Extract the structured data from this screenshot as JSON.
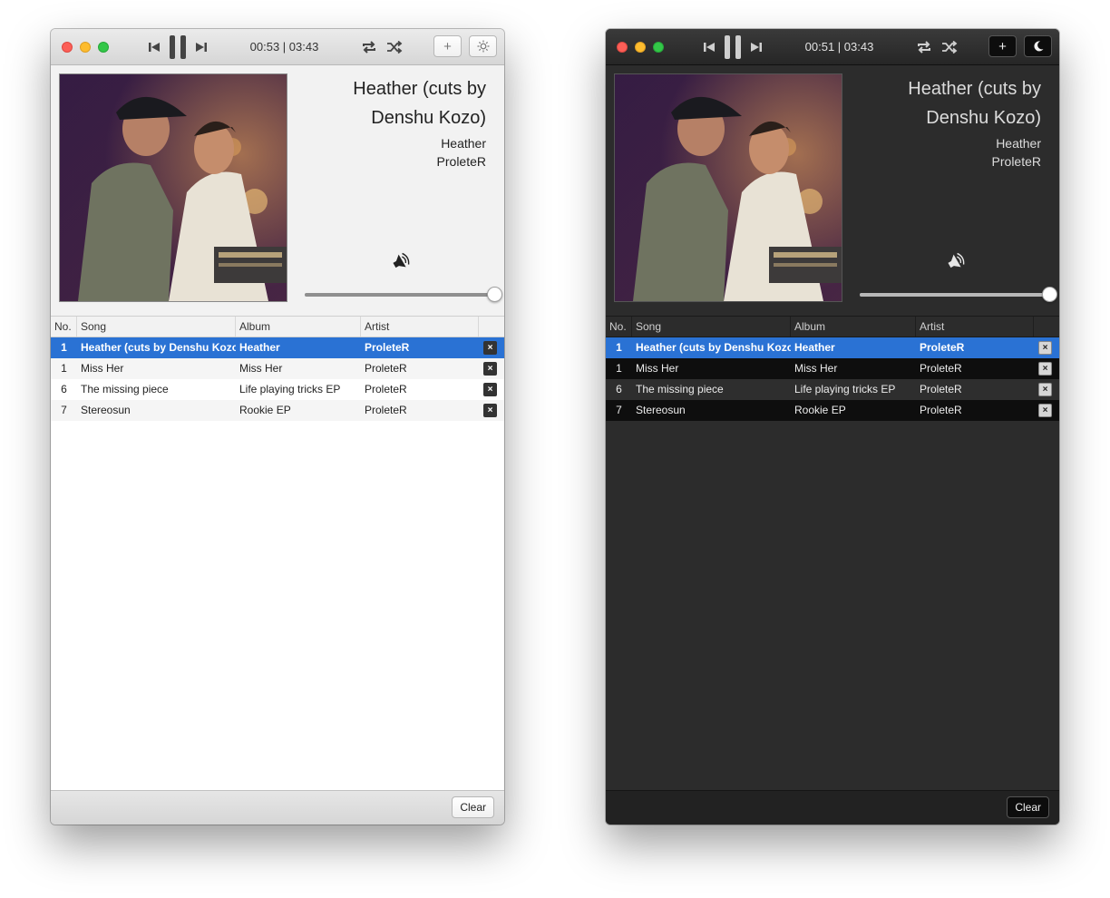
{
  "light": {
    "time": "00:53 | 03:43",
    "now_playing": {
      "title": "Heather (cuts by Denshu Kozo)",
      "album": "Heather",
      "artist": "ProleteR"
    },
    "volume": 1.0,
    "theme_icon": "sun-icon",
    "add_label": "+",
    "footer": {
      "clear_label": "Clear"
    }
  },
  "dark": {
    "time": "00:51 | 03:43",
    "now_playing": {
      "title": "Heather (cuts by Denshu Kozo)",
      "album": "Heather",
      "artist": "ProleteR"
    },
    "volume": 1.0,
    "theme_icon": "moon-icon",
    "add_label": "+",
    "footer": {
      "clear_label": "Clear"
    }
  },
  "columns": {
    "no": "No.",
    "song": "Song",
    "album": "Album",
    "artist": "Artist"
  },
  "tracks": [
    {
      "no": "1",
      "song": "Heather (cuts by Denshu Kozo)",
      "album": "Heather",
      "artist": "ProleteR",
      "selected": true
    },
    {
      "no": "1",
      "song": "Miss Her",
      "album": "Miss Her",
      "artist": "ProleteR",
      "selected": false
    },
    {
      "no": "6",
      "song": "The missing piece",
      "album": "Life playing tricks EP",
      "artist": "ProleteR",
      "selected": false
    },
    {
      "no": "7",
      "song": "Stereosun",
      "album": "Rookie EP",
      "artist": "ProleteR",
      "selected": false
    }
  ],
  "remove_label": "×",
  "colors": {
    "selection": "#2a72d4",
    "close": "#fc5f57",
    "minimize": "#fdbc2e",
    "maximize": "#33c748"
  }
}
